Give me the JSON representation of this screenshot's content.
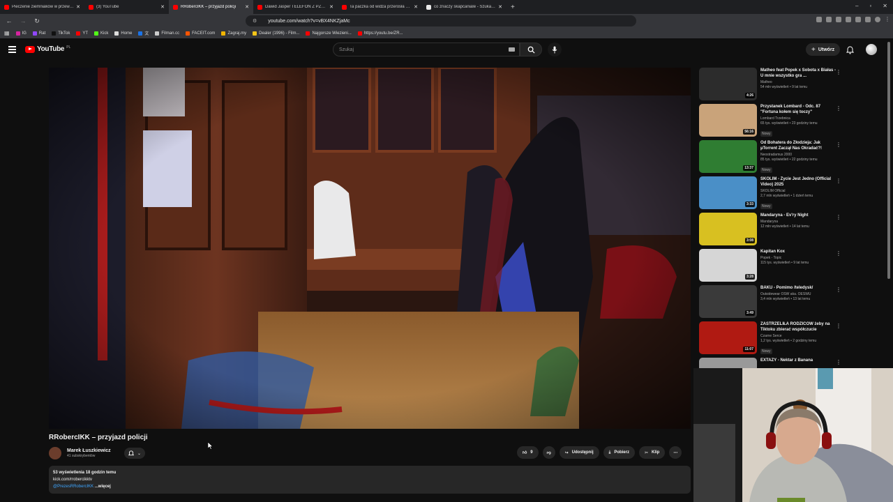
{
  "browser": {
    "tabs": [
      {
        "title": "Pieczenie ziemniaków w przewróco",
        "color": "#ff0000",
        "active": false
      },
      {
        "title": "(3) YouTube",
        "color": "#ff0000",
        "active": false
      },
      {
        "title": "RRobercIKK – przyjazd policji",
        "color": "#ff0000",
        "active": true
      },
      {
        "title": "Dawid Jasper TELEFON Z PZU - YouT",
        "color": "#ff0000",
        "active": false
      },
      {
        "title": "Ta paczka od widza przerosła nasze",
        "color": "#ff0000",
        "active": false
      },
      {
        "title": "co znaczy skapcaniale - Szukaj w Goo",
        "color": "#e8e8e8",
        "active": false
      }
    ],
    "url": "youtube.com/watch?v=vBX4NKZjaMc",
    "bookmarks": [
      {
        "label": "IG",
        "color": "#d6249f"
      },
      {
        "label": "Rat",
        "color": "#9147ff"
      },
      {
        "label": "TikTok",
        "color": "#111111"
      },
      {
        "label": "YT",
        "color": "#ff0000"
      },
      {
        "label": "Kick",
        "color": "#53fc18"
      },
      {
        "label": "Home",
        "color": "#dddddd"
      },
      {
        "label": "文",
        "color": "#1a73e8"
      },
      {
        "label": "Filman.cc",
        "color": "#cccccc"
      },
      {
        "label": "FACEIT.com",
        "color": "#ff5500"
      },
      {
        "label": "Zagraj.my",
        "color": "#f0b400"
      },
      {
        "label": "Dealer (1996) - Film...",
        "color": "#f5c518"
      },
      {
        "label": "Najgorsze Wiezieni...",
        "color": "#ff0000"
      },
      {
        "label": "https://youtu.be/ZR...",
        "color": "#ff0000"
      }
    ]
  },
  "masthead": {
    "logo": "YouTube",
    "country": "PL",
    "search_placeholder": "Szukaj",
    "create_label": "Utwórz"
  },
  "video": {
    "title": "RRobercIKK – przyjazd policji",
    "channel": "Marek Łuszkiewicz",
    "subscribers": "41 subskrybentów",
    "likes": "9",
    "share": "Udostępnij",
    "download": "Pobierz",
    "clip": "Klip",
    "views_time": "53 wyświetlenia  18 godzin temu",
    "desc_line1": "kick.com/rrobercikktv",
    "desc_handle": "@PrezesRRobercIKK",
    "desc_more": "...więcej"
  },
  "sidebar": [
    {
      "title": "Matheo feat Popek x Sobota x Białas - U mnie wszystko gra ...",
      "channel": "Matheo",
      "views": "54 mln wyświetleń • 9 lat temu",
      "duration": "4:26",
      "new": "",
      "thumb": "#2c2c2c"
    },
    {
      "title": "Przystanek Lombard - Odc. 87 \"Fortuna kołem się toczy\"",
      "channel": "Lombard Trzebnica",
      "views": "65 tys. wyświetleń • 23 godziny temu",
      "duration": "56:16",
      "new": "Nowy",
      "thumb": "#c9a37a"
    },
    {
      "title": "Od Bohatera do Złodzieja: Jak µTorrent Zaczął Nas Okradać?!",
      "channel": "Neostradamus 2000",
      "views": "85 tys. wyświetleń • 22 godziny temu",
      "duration": "13:37",
      "new": "Nowy",
      "thumb": "#2f7d32"
    },
    {
      "title": "SKOLIM - Życie Jest Jedno (Official Video) 2025",
      "channel": "SKOLIM Official",
      "views": "2,7 mln wyświetleń • 1 dzień temu",
      "duration": "3:33",
      "new": "Nowy",
      "thumb": "#4a8fc7"
    },
    {
      "title": "Mandaryna - Ev'ry Night",
      "channel": "Mandaryna",
      "views": "12 mln wyświetleń • 14 lat temu",
      "duration": "3:08",
      "new": "",
      "thumb": "#d8c021"
    },
    {
      "title": "Kapitan Kox",
      "channel": "Popek - Topic",
      "views": "115 tys. wyświetleń • 9 lat temu",
      "duration": "3:28",
      "new": "",
      "thumb": "#d6d6d6"
    },
    {
      "title": "BAKU - Pomimo /teledysk/",
      "channel": "Outsidewear OSW aka. OESWU",
      "views": "3,4 mln wyświetleń • 13 lat temu",
      "duration": "3:49",
      "new": "",
      "thumb": "#3a3a3a"
    },
    {
      "title": "ZASTRZELIŁA RODZICÓW żeby na Tiktoku zbierać współczucie",
      "channel": "Czarne Serce",
      "views": "1,2 tys. wyświetleń • 2 godziny temu",
      "duration": "11:07",
      "new": "Nowy",
      "thumb": "#b01a12"
    },
    {
      "title": "EXTAZY - Nektar z Banana",
      "channel": "",
      "views": "",
      "duration": "",
      "new": "",
      "thumb": "#999999"
    }
  ],
  "colors": {
    "accent": "#ff0000",
    "bg": "#0f0f0f",
    "chip": "#272727",
    "link": "#3ea6ff"
  }
}
